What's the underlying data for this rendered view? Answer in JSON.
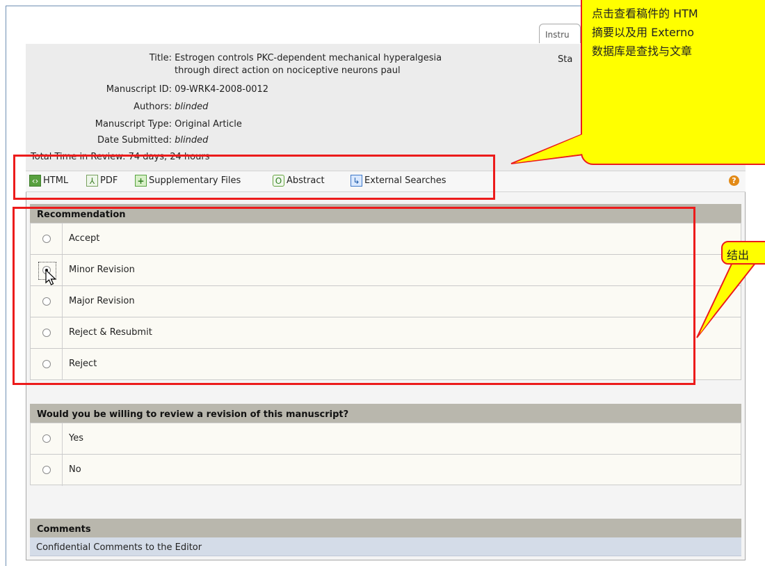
{
  "tab": {
    "label": "Instru"
  },
  "manuscript": {
    "title_label": "Title:",
    "title_value_line1": "Estrogen controls PKC-dependent mechanical hyperalgesia",
    "title_value_line2": "through direct action on nociceptive neurons paul",
    "id_label": "Manuscript ID:",
    "id_value": "09-WRK4-2008-0012",
    "authors_label": "Authors:",
    "authors_value": "blinded",
    "type_label": "Manuscript Type:",
    "type_value": "Original Article",
    "date_label": "Date Submitted:",
    "date_value": "blinded",
    "time_label": "Total Time in Review:",
    "time_value": "74 days, 24 hours",
    "status_label": "Sta"
  },
  "toolbar": {
    "html": "HTML",
    "pdf": "PDF",
    "supplementary": "Supplementary Files",
    "abstract": "Abstract",
    "external": "External Searches"
  },
  "recommendation": {
    "heading": "Recommendation",
    "options": [
      "Accept",
      "Minor Revision",
      "Major Revision",
      "Reject & Resubmit",
      "Reject"
    ],
    "selected": "Minor Revision"
  },
  "willing": {
    "heading": "Would you be willing to review a revision of this manuscript?",
    "options": [
      "Yes",
      "No"
    ]
  },
  "comments": {
    "heading": "Comments",
    "subheading": "Confidential Comments to the Editor"
  },
  "annotations": {
    "callout_top_lines": [
      "点击查看稿件的 HTM",
      "摘要以及用 Externo",
      "数据库是查找与文章"
    ],
    "callout_right": "结出"
  },
  "colors": {
    "highlight": "#ec1b1b",
    "callout_fill": "#ffff00",
    "section_head": "#b9b7ad"
  }
}
